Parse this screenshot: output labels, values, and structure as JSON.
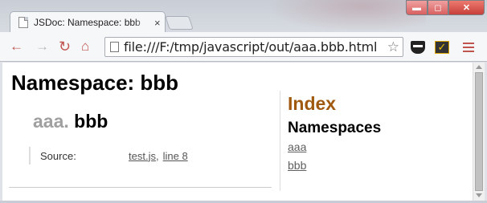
{
  "browser": {
    "tab_title": "JSDoc: Namespace: bbb",
    "tab_close": "×",
    "url": "file:///F:/tmp/javascript/out/aaa.bbb.html",
    "window_controls": {
      "minimize": "▬",
      "maximize": "◻",
      "close": "✕"
    },
    "icons": [
      "back-icon",
      "forward-icon",
      "reload-icon",
      "home-icon",
      "star-icon",
      "mask-extension-icon",
      "checkmark-extension-icon",
      "menu-icon"
    ]
  },
  "page": {
    "title": "Namespace: bbb",
    "namespace_prefix": "aaa.",
    "namespace_name": "bbb",
    "source_label": "Source:",
    "source_file": "test.js",
    "source_separator": ",",
    "source_line": "line 8"
  },
  "index": {
    "title": "Index",
    "subtitle": "Namespaces",
    "links": [
      "aaa",
      "bbb"
    ]
  },
  "colors": {
    "index_title": "#a05a10",
    "nav_accent": "#c0544e",
    "prefix_gray": "#a0a0a0"
  }
}
